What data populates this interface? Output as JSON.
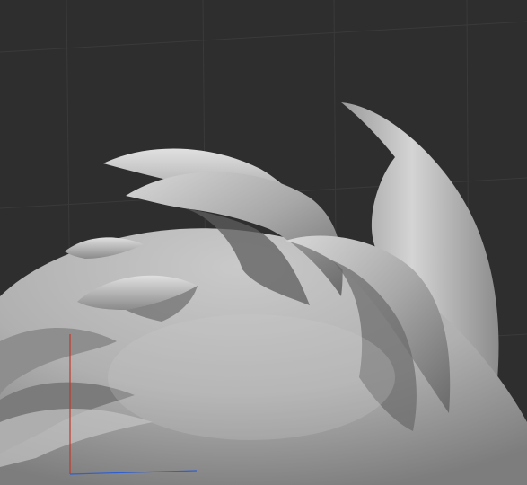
{
  "viewport": {
    "background": "#2e2e2e",
    "grid_color": "#3a3a3a",
    "axis_x_color": "#c0392b",
    "axis_y_color": "#2f5fd0",
    "mesh_base_color": "#b5b5b5",
    "mesh_shadow_color": "#5a5a5a",
    "mesh_highlight_color": "#e2e2e2"
  }
}
